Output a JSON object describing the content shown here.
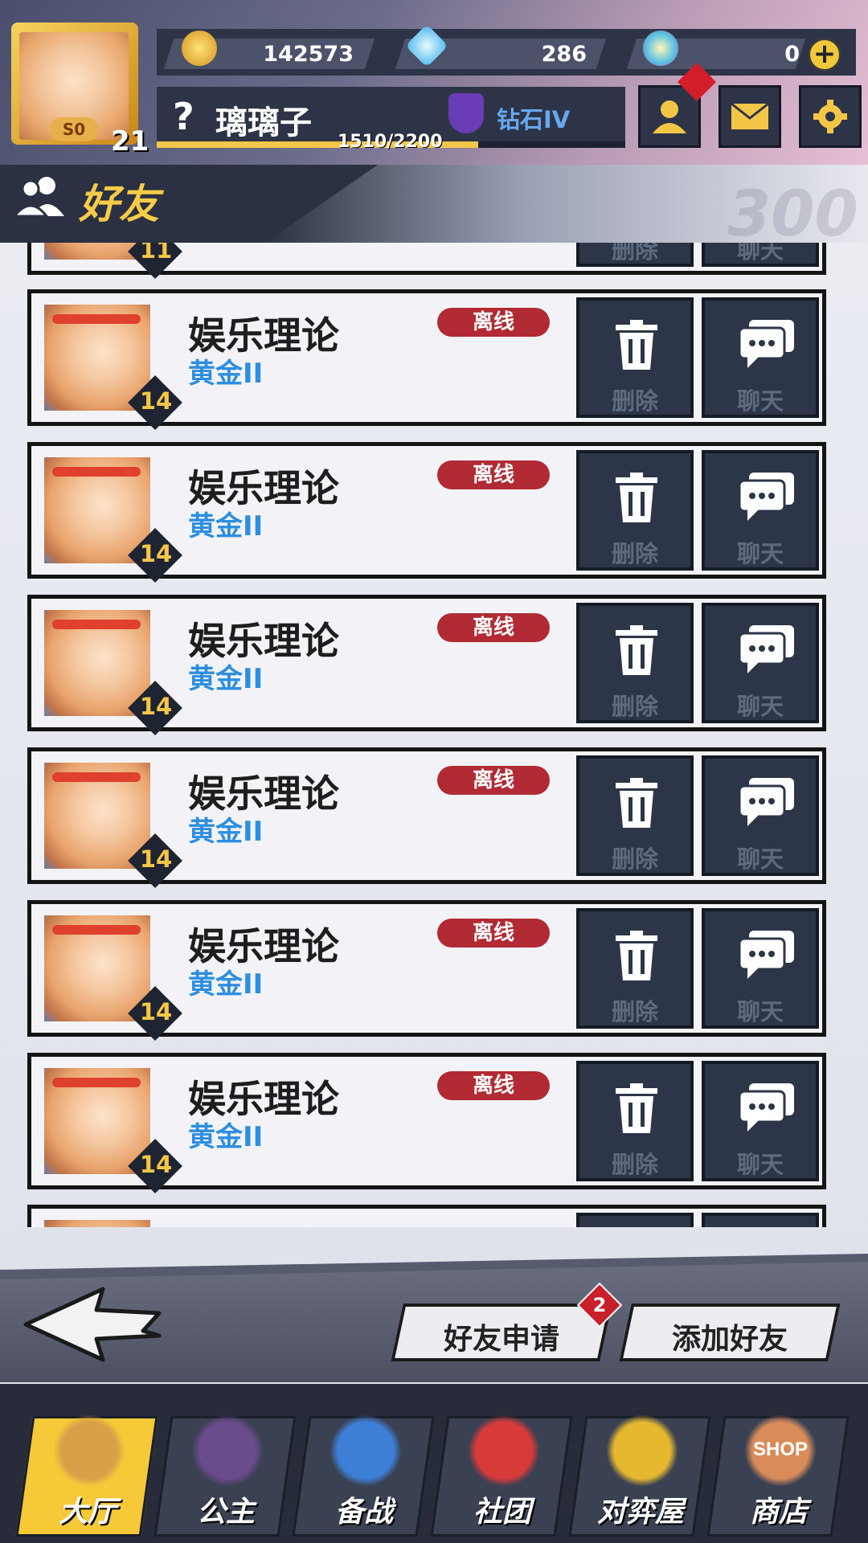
{
  "currency": {
    "gold": "142573",
    "diamond": "286",
    "ticket": "0",
    "add_symbol": "+"
  },
  "profile": {
    "frame_badge": "S0",
    "level": "21",
    "unknown_mark": "?",
    "name": "璃璃子",
    "rank": "钻石IV",
    "xp_text": "1510/2200",
    "xp_fraction": 0.686
  },
  "section": {
    "title": "好友",
    "watermark": "300"
  },
  "friends": [
    {
      "name": "娱乐理论",
      "rank": "黄金II",
      "level": "14",
      "status": "离线"
    },
    {
      "name": "娱乐理论",
      "rank": "黄金II",
      "level": "14",
      "status": "离线"
    },
    {
      "name": "娱乐理论",
      "rank": "黄金II",
      "level": "14",
      "status": "离线"
    },
    {
      "name": "娱乐理论",
      "rank": "黄金II",
      "level": "14",
      "status": "离线"
    },
    {
      "name": "娱乐理论",
      "rank": "黄金II",
      "level": "14",
      "status": "离线"
    },
    {
      "name": "娱乐理论",
      "rank": "黄金II",
      "level": "14",
      "status": "离线"
    }
  ],
  "partial_top": {
    "level": "11",
    "delete_label": "删除",
    "chat_label": "聊天"
  },
  "actions": {
    "delete_label": "删除",
    "chat_label": "聊天"
  },
  "bottom_actions": {
    "friend_requests": "好友申请",
    "friend_requests_count": "2",
    "add_friend": "添加好友"
  },
  "nav": [
    {
      "label": "大厅",
      "active": true
    },
    {
      "label": "公主",
      "active": false
    },
    {
      "label": "备战",
      "active": false
    },
    {
      "label": "社团",
      "active": false
    },
    {
      "label": "对弈屋",
      "active": false
    },
    {
      "label": "商店",
      "active": false
    }
  ],
  "shop_sign": "SHOP",
  "colors": {
    "accent_yellow": "#f4c647",
    "offline_red": "#b22a33",
    "rank_blue": "#2d8ee0",
    "panel_dark": "#2e3447"
  }
}
